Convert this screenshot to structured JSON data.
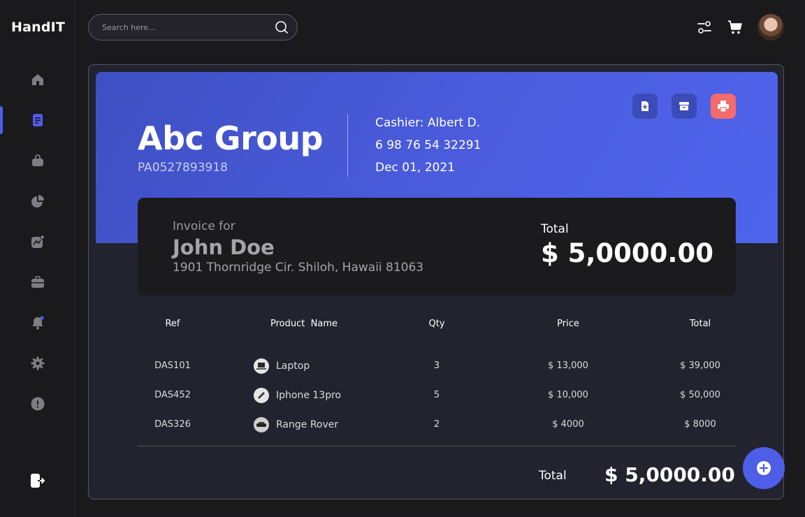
{
  "app": {
    "brand": "HandIT"
  },
  "search": {
    "placeholder": "Search here..."
  },
  "sidebar": {
    "items": [
      {
        "name": "home",
        "icon": "home-icon"
      },
      {
        "name": "invoices",
        "icon": "document-icon",
        "active": true
      },
      {
        "name": "shop",
        "icon": "bag-icon"
      },
      {
        "name": "reports",
        "icon": "pie-chart-icon"
      },
      {
        "name": "analytics",
        "icon": "trend-icon"
      },
      {
        "name": "portfolio",
        "icon": "briefcase-icon"
      },
      {
        "name": "notifications",
        "icon": "bell-icon"
      },
      {
        "name": "settings",
        "icon": "gear-icon"
      },
      {
        "name": "help",
        "icon": "alert-icon"
      }
    ],
    "logout_icon": "logout-icon"
  },
  "colors": {
    "accent": "#4e5ee8",
    "print": "#f46b6b",
    "card_bg": "#232330",
    "panel_bg": "#1b1b1e"
  },
  "invoice": {
    "company": "Abc Group",
    "company_id": "PA0527893918",
    "cashier": "Cashier:  Albert D.",
    "phone": "6 98 76 54 32291",
    "date": "Dec 01, 2021",
    "invoice_for_label": "Invoice for",
    "customer_name": "John Doe",
    "customer_address": "1901 Thornridge Cir. Shiloh, Hawaii 81063",
    "total_label": "Total",
    "total_value": "$ 5,0000.00"
  },
  "table": {
    "headers": [
      "Ref",
      "Product  Name",
      "Qty",
      "Price",
      "Total"
    ],
    "rows": [
      {
        "ref": "DAS101",
        "product": "Laptop",
        "qty": "3",
        "price": "$ 13,000",
        "total": "$ 39,000"
      },
      {
        "ref": "DAS452",
        "product": "Iphone 13pro",
        "qty": "5",
        "price": "$ 10,000",
        "total": "$ 50,000"
      },
      {
        "ref": "DAS326",
        "product": "Range Rover",
        "qty": "2",
        "price": "$ 4000",
        "total": "$ 8000"
      }
    ],
    "footer_label": "Total",
    "footer_total": "$ 5,0000.00"
  }
}
